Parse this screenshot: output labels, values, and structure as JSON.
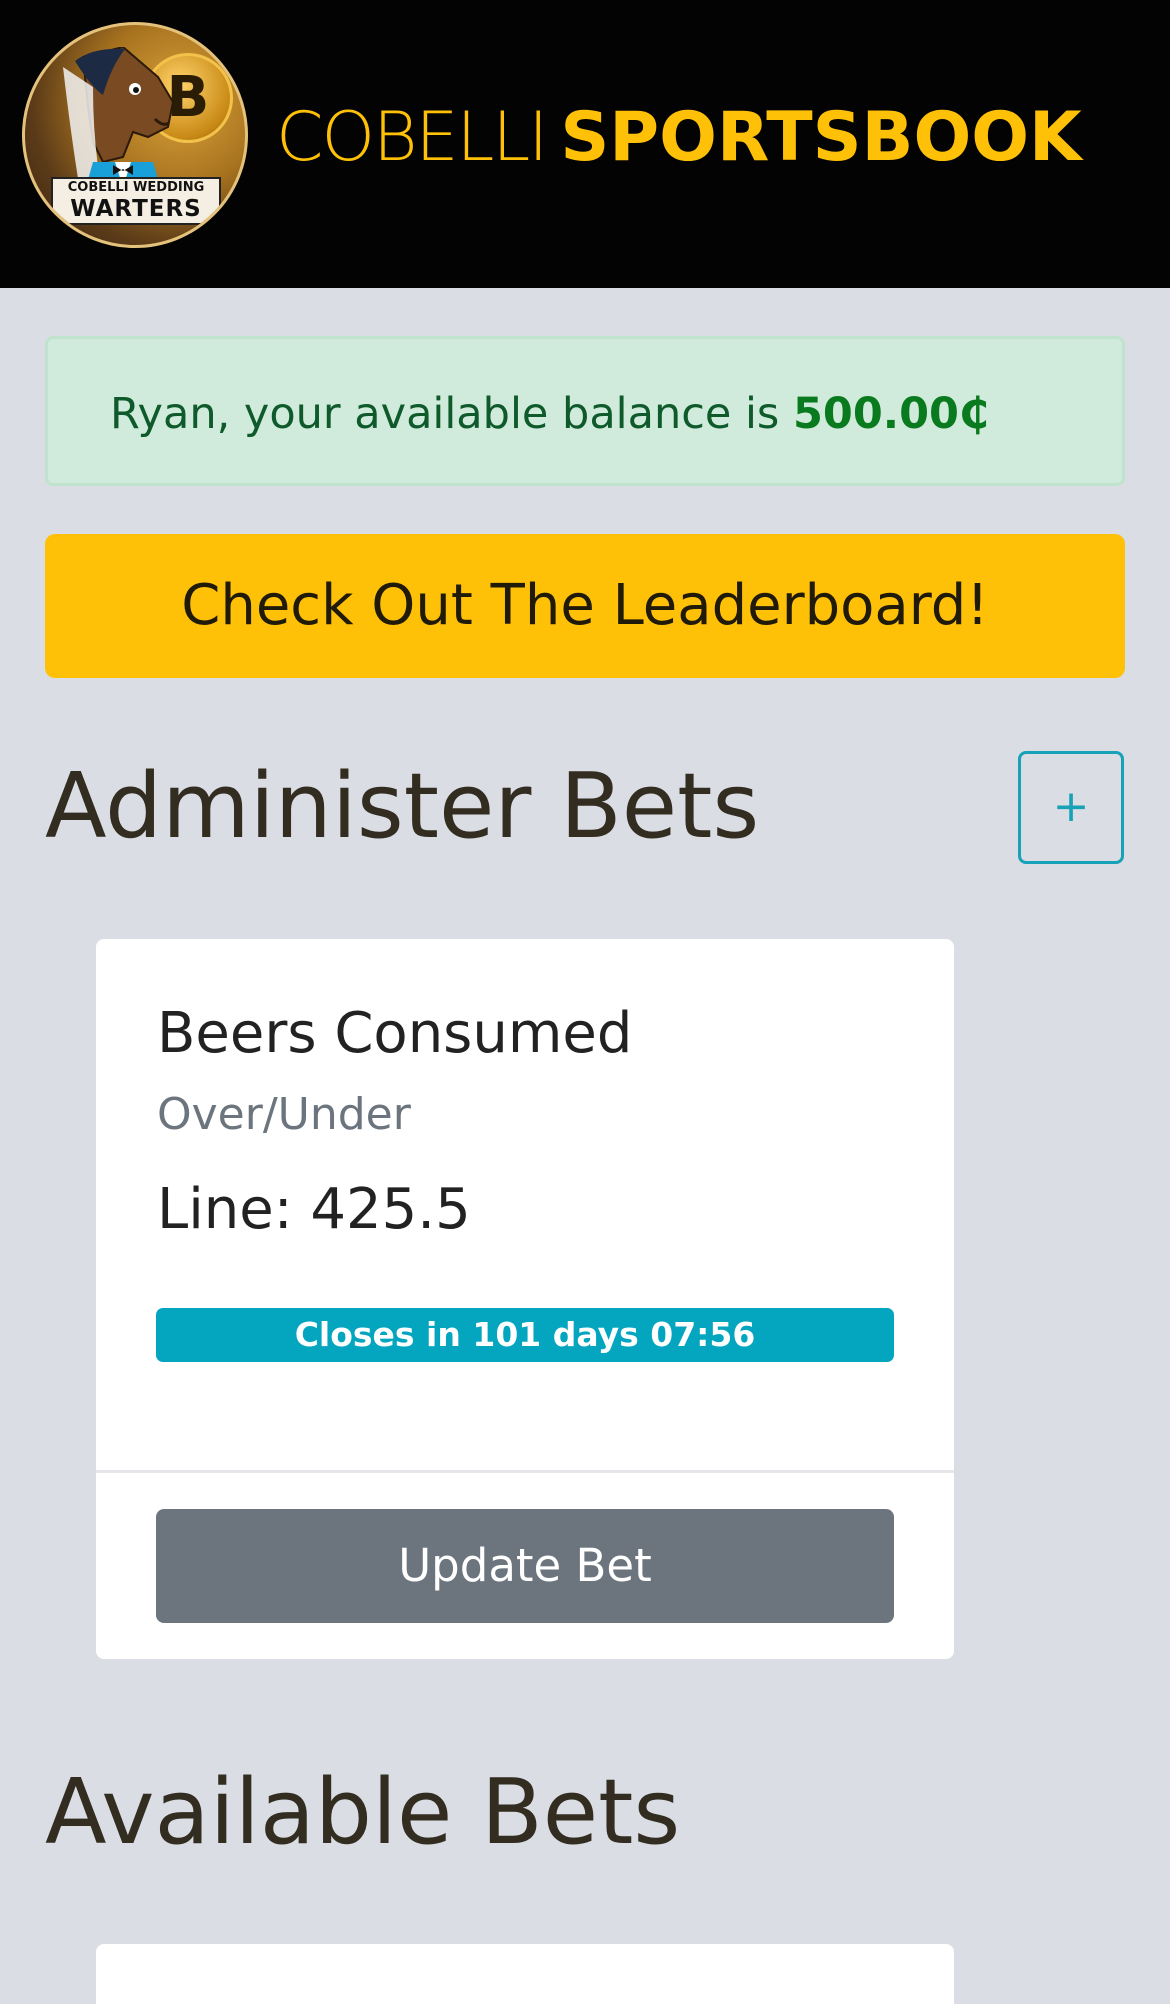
{
  "header": {
    "logo": {
      "icon": "horse-groom-bitcoin-logo",
      "banner_line1": "COBELLI WEDDING",
      "banner_line2": "WARTERS",
      "coin_symbol": "B"
    },
    "brand_light": "COBELLI",
    "brand_bold": "SPORTSBOOK",
    "brand_color": "#ffc107",
    "background": "#030303"
  },
  "balance_alert": {
    "prefix": "Ryan, your available balance is ",
    "amount": "500.00₵"
  },
  "leaderboard_button": {
    "label": "Check Out The Leaderboard!"
  },
  "admin_section": {
    "title": "Administer Bets",
    "add_button": {
      "label": "+",
      "icon": "plus-icon"
    },
    "bets": [
      {
        "title": "Beers Consumed",
        "type": "Over/Under",
        "line_label": "Line: ",
        "line_value": "425.5",
        "countdown": "Closes in 101 days 07:56",
        "action_label": "Update Bet"
      }
    ]
  },
  "available_section": {
    "title": "Available Bets"
  },
  "colors": {
    "page_bg": "#dadde4",
    "alert_bg": "#d0ebdc",
    "alert_text": "#0e5a2a",
    "warning": "#ffc107",
    "info": "#17a2b8",
    "countdown_bg": "#04a5bf",
    "secondary": "#6c757d"
  }
}
